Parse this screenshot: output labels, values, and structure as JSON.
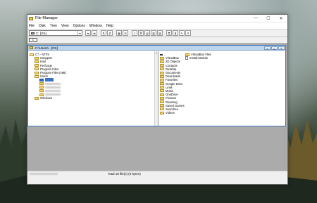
{
  "window": {
    "title": "File Manager",
    "controls": {
      "minimize": "—",
      "maximize": "☐",
      "close": "✕"
    }
  },
  "menu": [
    "File",
    "Disk",
    "Tree",
    "View",
    "Options",
    "Window",
    "Help"
  ],
  "toolbar": {
    "drive_value": "C: [OS]",
    "combo_arrow": "▾",
    "drive_tab_label": "C"
  },
  "child_window": {
    "title": "C:\\Users\\          - [OS]",
    "buttons": [
      "▭",
      "◻",
      "✕"
    ]
  },
  "tree": [
    {
      "label": "C:\\ - NTFS",
      "depth": 0,
      "state": "open"
    },
    {
      "label": "eSupport",
      "depth": 1,
      "state": "closed"
    },
    {
      "label": "Intel",
      "depth": 1,
      "state": "closed"
    },
    {
      "label": "PerfLogs",
      "depth": 1,
      "state": "closed"
    },
    {
      "label": "Program Files",
      "depth": 1,
      "state": "closed"
    },
    {
      "label": "Program Files (x86)",
      "depth": 1,
      "state": "closed"
    },
    {
      "label": "Users",
      "depth": 1,
      "state": "open"
    },
    {
      "label": "",
      "depth": 2,
      "state": "selected"
    },
    {
      "label": "",
      "depth": 2,
      "state": "blurred"
    },
    {
      "label": "",
      "depth": 2,
      "state": "blurred"
    },
    {
      "label": "",
      "depth": 2,
      "state": "blurred"
    },
    {
      "label": "",
      "depth": 2,
      "state": "blurred"
    },
    {
      "label": "Windows",
      "depth": 1,
      "state": "closed"
    }
  ],
  "files_col1": [
    {
      "label": "..",
      "kind": "up"
    },
    {
      "label": "VirtualBox",
      "kind": "folder"
    },
    {
      "label": "3D Objects",
      "kind": "folder"
    },
    {
      "label": "Contacts",
      "kind": "folder"
    },
    {
      "label": "Desktop",
      "kind": "folder"
    },
    {
      "label": "Documents",
      "kind": "folder"
    },
    {
      "label": "Downloads",
      "kind": "folder"
    },
    {
      "label": "Favorites",
      "kind": "folder"
    },
    {
      "label": "Google Drive",
      "kind": "folder"
    },
    {
      "label": "Links",
      "kind": "folder"
    },
    {
      "label": "Music",
      "kind": "folder"
    },
    {
      "label": "OneDrive",
      "kind": "folder"
    },
    {
      "label": "Pictures",
      "kind": "folder"
    },
    {
      "label": "Roaming",
      "kind": "folder"
    },
    {
      "label": "Saved Games",
      "kind": "folder"
    },
    {
      "label": "Searches",
      "kind": "folder"
    },
    {
      "label": "Videos",
      "kind": "folder"
    }
  ],
  "files_col2": [
    {
      "label": "VirtualBox VMs",
      "kind": "folder"
    },
    {
      "label": "Install-Module",
      "kind": "doc"
    }
  ],
  "status": {
    "right": "Total 18 file(s) (0 bytes)"
  }
}
